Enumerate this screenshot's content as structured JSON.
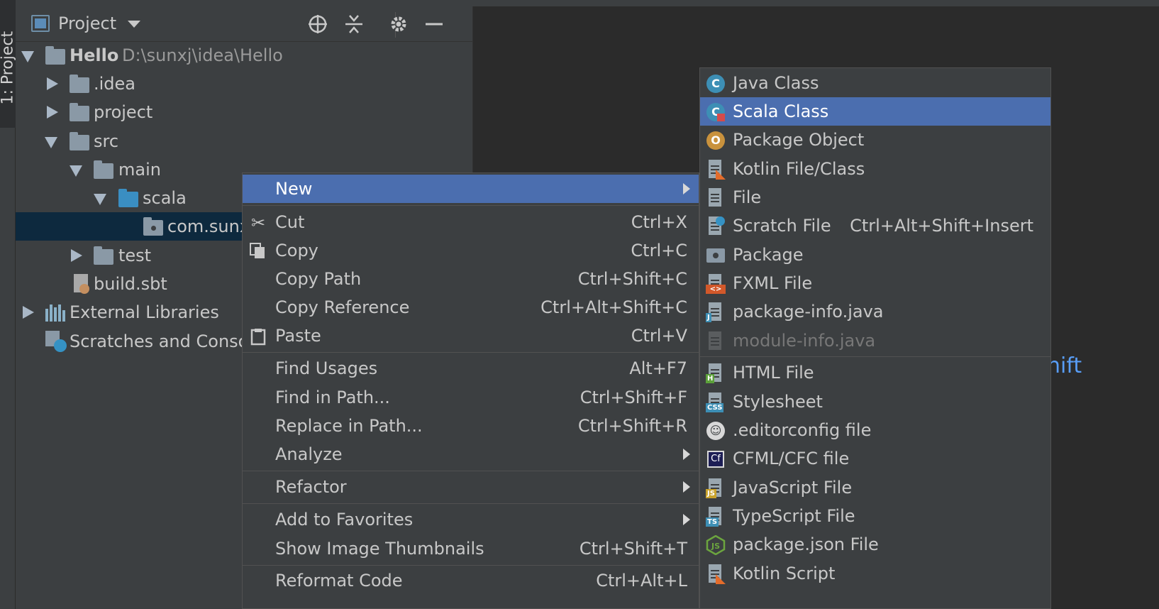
{
  "toolstrip": {
    "project_tab": "1: Project"
  },
  "panel": {
    "title": "Project"
  },
  "tree": {
    "root_name": "Hello",
    "root_path": "D:\\sunxj\\idea\\Hello",
    "idea": ".idea",
    "project": "project",
    "src": "src",
    "main": "main",
    "scala": "scala",
    "package": "com.sunx",
    "test": "test",
    "build": "build.sbt",
    "external_libraries": "External Libraries",
    "scratches": "Scratches and Console"
  },
  "editor": {
    "hint_fragment": "hift"
  },
  "context_menu": {
    "new": "New",
    "cut": {
      "label": "Cut",
      "shortcut": "Ctrl+X"
    },
    "copy": {
      "label": "Copy",
      "shortcut": "Ctrl+C"
    },
    "copy_path": {
      "label": "Copy Path",
      "shortcut": "Ctrl+Shift+C"
    },
    "copy_reference": {
      "label": "Copy Reference",
      "shortcut": "Ctrl+Alt+Shift+C"
    },
    "paste": {
      "label": "Paste",
      "shortcut": "Ctrl+V"
    },
    "find_usages": {
      "label": "Find Usages",
      "shortcut": "Alt+F7"
    },
    "find_in_path": {
      "label": "Find in Path...",
      "shortcut": "Ctrl+Shift+F"
    },
    "replace_in_path": {
      "label": "Replace in Path...",
      "shortcut": "Ctrl+Shift+R"
    },
    "analyze": "Analyze",
    "refactor": "Refactor",
    "add_to_favorites": "Add to Favorites",
    "show_image_thumbnails": {
      "label": "Show Image Thumbnails",
      "shortcut": "Ctrl+Shift+T"
    },
    "reformat_code": {
      "label": "Reformat Code",
      "shortcut": "Ctrl+Alt+L"
    }
  },
  "new_submenu": {
    "java_class": "Java Class",
    "scala_class": "Scala Class",
    "package_object": "Package Object",
    "kotlin_file": "Kotlin File/Class",
    "file": "File",
    "scratch_file": {
      "label": "Scratch File",
      "shortcut": "Ctrl+Alt+Shift+Insert"
    },
    "package": "Package",
    "fxml_file": "FXML File",
    "package_info": "package-info.java",
    "module_info": "module-info.java",
    "html_file": "HTML File",
    "stylesheet": "Stylesheet",
    "editorconfig": ".editorconfig file",
    "cfml": "CFML/CFC file",
    "javascript": "JavaScript File",
    "typescript": "TypeScript File",
    "package_json": "package.json File",
    "kotlin_script": "Kotlin Script"
  },
  "colors": {
    "selection": "#4b6eaf",
    "tree_selection": "#0d293e",
    "panel_bg": "#3c3f41",
    "editor_bg": "#2b2b2b",
    "link_blue": "#589df6"
  }
}
